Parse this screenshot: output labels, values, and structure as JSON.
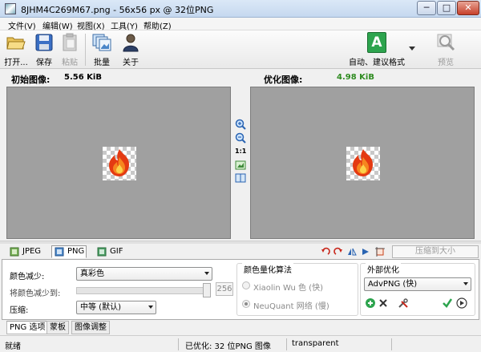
{
  "window": {
    "title": "8JHM4C269M67.png - 56x56 px @ 32位PNG",
    "minimize": "─",
    "maximize": "□",
    "close": "✕"
  },
  "menu": [
    "文件(V)",
    "编辑(W)",
    "视图(X)",
    "工具(Y)",
    "帮助(Z)"
  ],
  "toolbar": {
    "open": "打开...",
    "save": "保存",
    "paste": "粘贴",
    "batch": "批量",
    "about": "关于",
    "auto_suggest": "自动、建议格式",
    "auto_badge": "A",
    "preview": "预览"
  },
  "original": {
    "label": "初始图像:",
    "size": "5.56 KiB"
  },
  "optimized": {
    "label": "优化图像:",
    "size": "4.98 KiB"
  },
  "zoom_ratio": "1:1",
  "formats": {
    "jpeg": "JPEG",
    "png": "PNG",
    "gif": "GIF",
    "compress_label": "压缩到大小"
  },
  "options": {
    "color_reduce_label": "颜色减少:",
    "color_reduce_value": "真彩色",
    "reduce_to_label": "将颜色减少到:",
    "reduce_to_value": "256",
    "compress_label": "压缩:",
    "compress_value": "中等 (默认)",
    "quant_title": "颜色量化算法",
    "quant_opt1": "Xiaolin Wu 色 (快)",
    "quant_opt2": "NeuQuant 网络 (慢)",
    "external_title": "外部优化",
    "external_value": "AdvPNG (快)"
  },
  "subtabs": [
    "PNG 选项",
    "蒙板",
    "图像调整"
  ],
  "status": {
    "ready": "就绪",
    "optimized": "已优化: 32 位PNG 图像",
    "transparency": "transparent"
  },
  "colors": {
    "optimized_size": "#2e8b20",
    "accent_green": "#2da44e",
    "pane_gray": "#a0a0a0"
  }
}
